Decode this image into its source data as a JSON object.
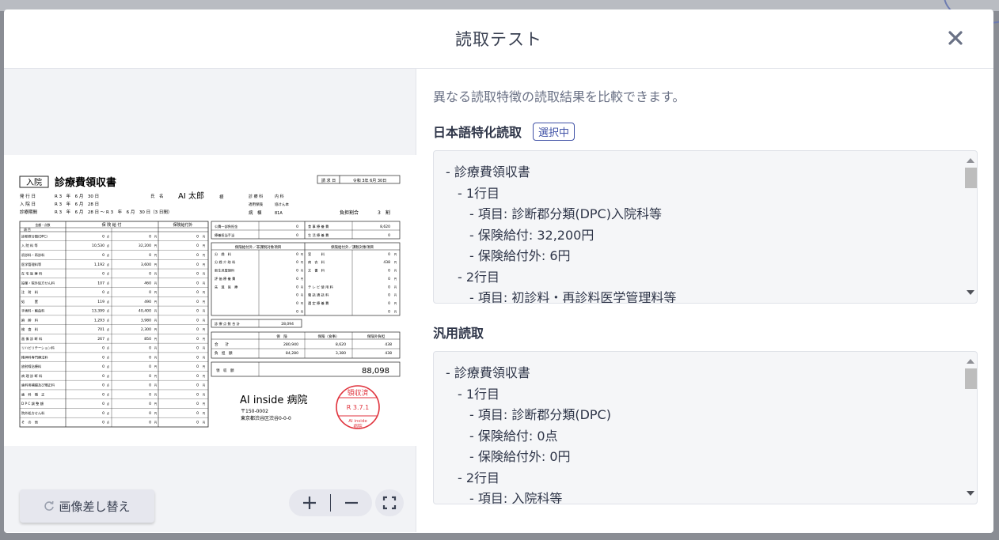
{
  "modal": {
    "title": "読取テスト",
    "close_icon": "close-icon"
  },
  "left": {
    "replace_button": "画像差し替え",
    "zoom_in_icon": "plus-icon",
    "zoom_out_icon": "minus-icon",
    "fit_icon": "fullscreen-icon"
  },
  "receipt": {
    "admission_tag": "入院",
    "title": "診療費領収書",
    "request_date_label": "請 求 日",
    "request_date": "令和 3年 6月 30日",
    "rows_left": [
      {
        "label": "発 行 日",
        "value": "R 3　年　6 月　30 日"
      },
      {
        "label": "入 院 日",
        "value": "R 3　年　6 月　28 日"
      },
      {
        "label": "診療期間",
        "value": "R 3　年　6 月　28 日 ～ R 3　年　6 月　30 日（3 日間）"
      }
    ],
    "name_label": "氏　名",
    "name": "AI 太郎",
    "sama": "様",
    "dept_label": "診 療 科",
    "dept": "内 科",
    "insurance_label": "適用保険",
    "insurance": "協けん本",
    "ward_label": "病　棟",
    "ward": "81A",
    "burden_label": "負担割合",
    "burden": "3　割",
    "table_headers": [
      "項 目",
      "保 険 給 付",
      "保険給付外"
    ],
    "table_subheader": "金額・点数",
    "items": [
      {
        "name": "診断群分類(DPC)",
        "pts": "0",
        "ins": "0",
        "non": "0"
      },
      {
        "name": "入 院 料 等",
        "pts": "10,530",
        "ins": "32,200",
        "non": "0"
      },
      {
        "name": "初診料・再診料",
        "pts": "0",
        "ins": "0",
        "non": "0"
      },
      {
        "name": "医学管理料等",
        "pts": "1,192",
        "ins": "3,600",
        "non": "0"
      },
      {
        "name": "在 宅 医 療 料",
        "pts": "0",
        "ins": "0",
        "non": "0"
      },
      {
        "name": "投薬・院外処方せん料",
        "pts": "107",
        "ins": "460",
        "non": "0"
      },
      {
        "name": "注　射　料",
        "pts": "0",
        "ins": "0",
        "non": "0"
      },
      {
        "name": "処　　　置",
        "pts": "119",
        "ins": "490",
        "non": "0"
      },
      {
        "name": "手術料・輸血料",
        "pts": "13,399",
        "ins": "40,400",
        "non": "0"
      },
      {
        "name": "麻　酔　料",
        "pts": "1,293",
        "ins": "3,980",
        "non": "0"
      },
      {
        "name": "検　査　料",
        "pts": "701",
        "ins": "2,300",
        "non": "0"
      },
      {
        "name": "画 像 診 断 料",
        "pts": "267",
        "ins": "850",
        "non": "0"
      },
      {
        "name": "リハビリテーション料",
        "pts": "0",
        "ins": "0",
        "non": "0"
      },
      {
        "name": "精神科専門療法料",
        "pts": "0",
        "ins": "0",
        "non": "0"
      },
      {
        "name": "放射線治療料",
        "pts": "0",
        "ins": "0",
        "non": "0"
      },
      {
        "name": "病 理 診 断 料",
        "pts": "0",
        "ins": "0",
        "non": "0"
      },
      {
        "name": "歯科用補綴及び矯正料",
        "pts": "0",
        "ins": "0",
        "non": "0"
      },
      {
        "name": "歯　科　矯　正",
        "pts": "0",
        "ins": "0",
        "non": "0"
      },
      {
        "name": "D P C 調 整 額",
        "pts": "0",
        "ins": "0",
        "non": "0"
      },
      {
        "name": "院外処方せん料",
        "pts": "0",
        "ins": "0",
        "non": "0"
      },
      {
        "name": "そ　の　他",
        "pts": "0",
        "ins": "0",
        "non": "0"
      }
    ],
    "unit_pt": "点",
    "unit_yen": "円",
    "public_label": "公費一部負担金",
    "public": "0",
    "special_label": "療養担当手当",
    "special": "0",
    "meal_label": "食 事 療 養 費",
    "meal": "8,620",
    "life_label": "生 活 療 養 費",
    "life": "0",
    "non_tax_header": "保険給付外／非課税対象項目",
    "tax_header": "保険給付外／課税対象項目",
    "non_tax_items": [
      {
        "name": "分　娩　料",
        "v": "0"
      },
      {
        "name": "分 娩 介 助 料",
        "v": "0"
      },
      {
        "name": "新生児管理料",
        "v": "0"
      },
      {
        "name": "評 価 療 養 費",
        "v": "0"
      },
      {
        "name": "先　進　医　療",
        "v": "0"
      },
      {
        "name": "",
        "v": "0"
      },
      {
        "name": "",
        "v": "0"
      },
      {
        "name": "",
        "v": "0"
      }
    ],
    "tax_items": [
      {
        "name": "室　　　料",
        "v": "0"
      },
      {
        "name": "病　衣　料",
        "v": "438"
      },
      {
        "name": "文　書　料",
        "v": "0"
      },
      {
        "name": "",
        "v": "0"
      },
      {
        "name": "テ レ ビ 使 用 料",
        "v": "0"
      },
      {
        "name": "電 話 通 話 料",
        "v": "0"
      },
      {
        "name": "選 定 療 養 費",
        "v": "0"
      },
      {
        "name": "",
        "v": "0"
      }
    ],
    "total_points_label": "診 療 点 数 合 計",
    "total_points": "28,094",
    "sum_headers": [
      "保　険",
      "保険（食事）",
      "保険外負担"
    ],
    "sum_rows": [
      {
        "label": "合　　計",
        "a": "280,940",
        "b": "8,620",
        "c": "438"
      },
      {
        "label": "負　担　額",
        "a": "84,280",
        "b": "3,380",
        "c": "438"
      }
    ],
    "received_label": "領　収　額",
    "received": "88,098",
    "hospital": "AI inside 病院",
    "postal": "〒150-0002",
    "address": "東京都渋谷区渋谷0-0-0",
    "stamp_top": "領収済",
    "stamp_date": "R 3.7.1",
    "stamp_bottom1": "AI inside",
    "stamp_bottom2": "病院"
  },
  "right": {
    "description": "異なる読取特徴の読取結果を比較できます。",
    "section1": {
      "title": "日本語特化読取",
      "badge": "選択中",
      "lines": [
        "- 診療費領収書",
        "- 1行目",
        "- 項目: 診断郡分類(DPC)入院科等",
        "- 保険給付: 32,200円",
        "- 保険給付外: 6円",
        "- 2行目",
        "- 項目: 初診料・再診料医学管理料等"
      ]
    },
    "section2": {
      "title": "汎用読取",
      "lines": [
        "- 診療費領収書",
        "- 1行目",
        "- 項目: 診断郡分類(DPC)",
        "- 保険給付: 0点",
        "- 保険給付外: 0円",
        "- 2行目",
        "- 項目: 入院科等"
      ]
    }
  }
}
